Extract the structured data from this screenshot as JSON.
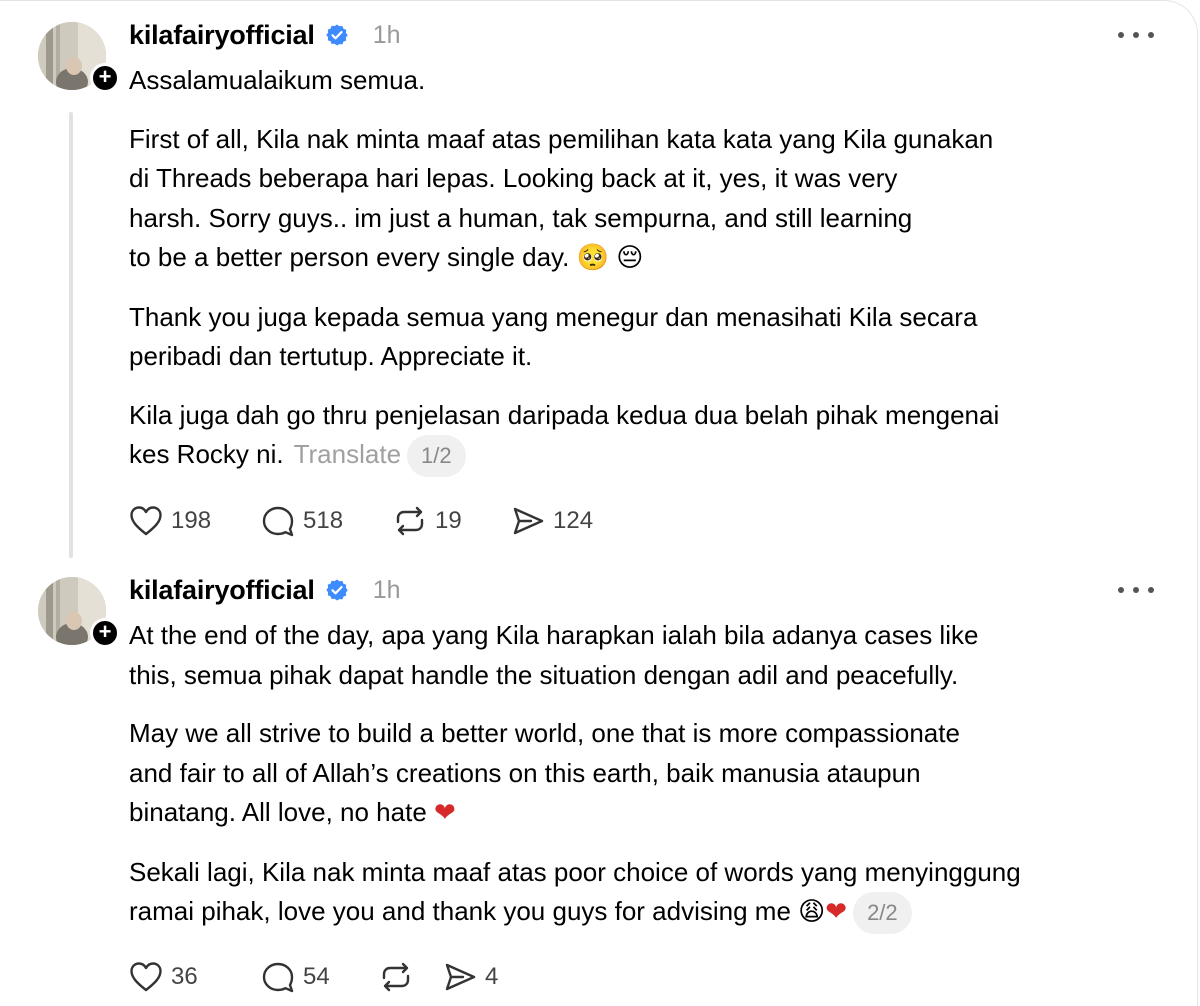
{
  "posts": [
    {
      "username": "kilafairyofficial",
      "time": "1h",
      "paragraphs": [
        "Assalamualaikum semua.",
        "First of all, Kila nak minta maaf atas pemilihan kata kata yang Kila gunakan\ndi Threads beberapa hari lepas. Looking back at it, yes, it was very\nharsh. Sorry guys.. im just a human, tak sempurna, and still learning\nto be a better person every single day.",
        "Thank you juga kepada semua yang menegur dan menasihati Kila secara\nperibadi dan tertutup. Appreciate it.",
        "Kila juga dah go thru penjelasan daripada kedua dua belah pihak mengenai\nkes Rocky ni."
      ],
      "emoji_1": "🥺",
      "emoji_2": "😔",
      "translate_label": "Translate",
      "page_indicator": "1/2",
      "likes": "198",
      "replies": "518",
      "reposts": "19",
      "shares": "124"
    },
    {
      "username": "kilafairyofficial",
      "time": "1h",
      "paragraphs": [
        "At the end of the day, apa yang Kila harapkan ialah bila adanya cases like\nthis, semua pihak dapat handle the situation dengan adil and peacefully.",
        "May we all strive to build a better world, one that is more compassionate\nand fair to all of Allah’s creations on this earth, baik manusia ataupun\nbinatang. All love, no hate",
        "Sekali lagi, Kila nak minta maaf atas poor choice of words yang menyinggung\nramai pihak, love you and thank you guys for advising me"
      ],
      "emoji_heart": "❤",
      "emoji_weary": "😩",
      "page_indicator": "2/2",
      "likes": "36",
      "replies": "54",
      "reposts": "",
      "shares": "4"
    }
  ],
  "colors": {
    "verified_blue": "#3d8bfd",
    "heart_red": "#d62a2a",
    "muted_text": "#999999",
    "thread_line": "#e2e2e2"
  },
  "icons": {
    "avatar_badge": "plus-icon",
    "verified": "verified-badge-icon",
    "more": "more-horizontal-icon",
    "like": "heart-icon",
    "reply": "comment-icon",
    "repost": "repost-icon",
    "share": "send-icon"
  }
}
